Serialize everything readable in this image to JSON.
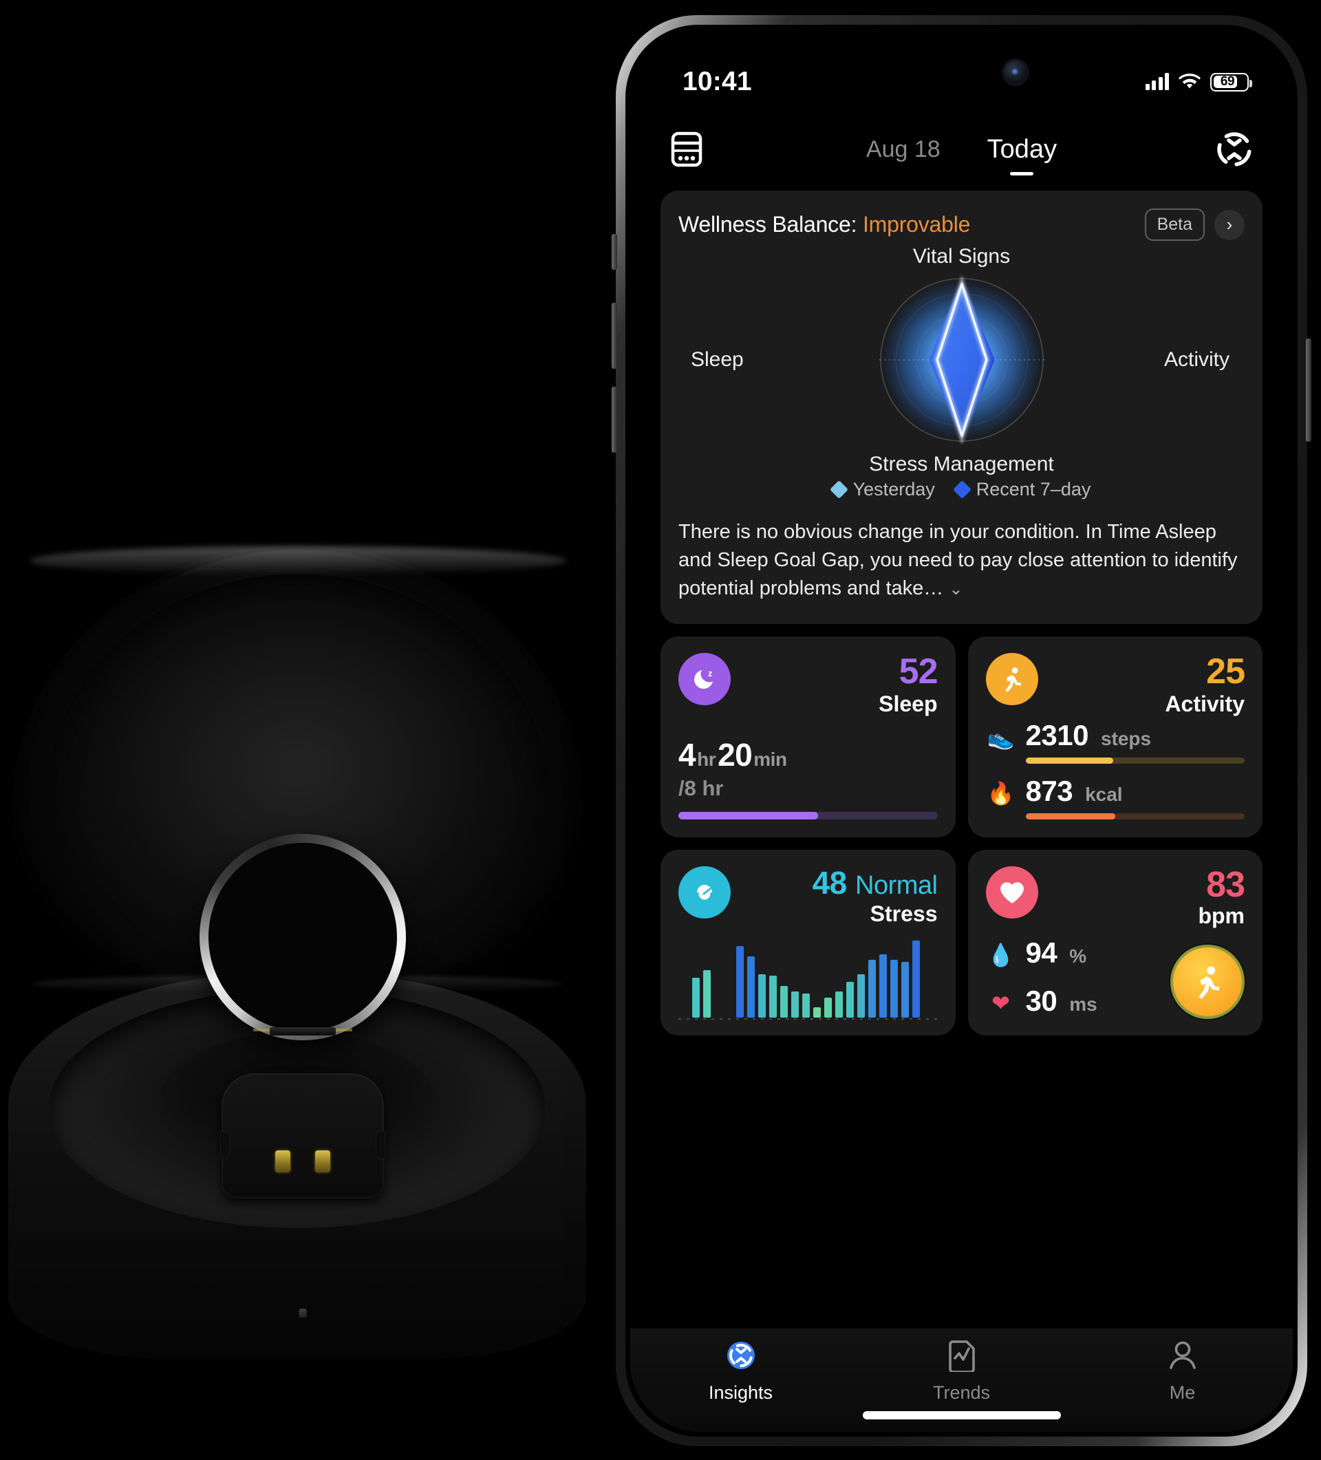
{
  "product": {
    "name": "smart-ring-charging-case",
    "description": "Black smart ring charging case with lid open and silver smart ring resting in the cradle"
  },
  "phone": {
    "status_bar": {
      "clock": "10:41",
      "signal_icon": "cellular-signal-icon",
      "wifi_icon": "wifi-icon",
      "battery_icon": "battery-icon",
      "battery_level": "69"
    },
    "home_indicator": "home-indicator"
  },
  "header": {
    "calendar_icon": "calendar-icon",
    "date": "Aug 18",
    "today": "Today",
    "refresh_icon": "refresh-icon"
  },
  "wellness": {
    "title_prefix": "Wellness Balance: ",
    "status": "Improvable",
    "status_color": "#e8903a",
    "beta_badge": "Beta",
    "chevron": "›",
    "description": "There is no obvious change in your condition. In Time Asleep and Sleep Goal Gap, you need to pay close attention to identify potential problems and take…",
    "expand_chevron": "⌄",
    "legend": [
      {
        "label": "Yesterday",
        "color": "#7fc8e8"
      },
      {
        "label": "Recent 7–day",
        "color": "#2b5fe8"
      }
    ]
  },
  "chart_data": {
    "type": "radar",
    "title": "Wellness Balance",
    "categories": [
      "Vital Signs",
      "Activity",
      "Stress Management",
      "Sleep"
    ],
    "axis_angles_deg": [
      270,
      0,
      90,
      180
    ],
    "rmax": 100,
    "grid": "concentric-rings-dotted-axes",
    "legend_position": "bottom",
    "series": [
      {
        "name": "Yesterday",
        "color": "#d9ecff",
        "values": [
          95,
          28,
          95,
          28
        ]
      },
      {
        "name": "Recent 7–day",
        "color": "#2b5fe8",
        "values": [
          88,
          40,
          88,
          40
        ]
      }
    ]
  },
  "metrics": {
    "sleep": {
      "icon": "sleep-moon-icon",
      "icon_color": "#9b5de5",
      "score": "52",
      "score_color": "#a86ef0",
      "label": "Sleep",
      "hours": "4",
      "hours_unit": "hr",
      "minutes": "20",
      "minutes_unit": "min",
      "goal": "/8 hr",
      "progress_pct": 54,
      "bar_color": "#a86ef0",
      "bar_track": "#3a2f4d"
    },
    "activity": {
      "icon": "running-person-icon",
      "icon_color": "#f5ab2e",
      "score": "25",
      "score_color": "#f5ab2e",
      "label": "Activity",
      "rows": [
        {
          "icon": "sneaker-icon",
          "glyph": "👟",
          "value": "2310",
          "unit": "steps",
          "progress_pct": 40,
          "color": "#f5c344",
          "track": "#4a3f22"
        },
        {
          "icon": "flame-icon",
          "glyph": "🔥",
          "value": "873",
          "unit": "kcal",
          "progress_pct": 41,
          "color": "#f07a3c",
          "track": "#472f24"
        }
      ]
    },
    "stress": {
      "icon": "stress-gauge-icon",
      "icon_color": "#2bbcd9",
      "score": "48",
      "word": "Normal",
      "score_color": "#35c4e0",
      "label": "Stress",
      "chart": {
        "type": "bar",
        "values": [
          0,
          40,
          48,
          0,
          0,
          72,
          62,
          44,
          42,
          32,
          26,
          24,
          10,
          20,
          26,
          36,
          44,
          58,
          64,
          58,
          56,
          78
        ],
        "colors": [
          "#3ba7c9",
          "#4bc3c0",
          "#59cfb4",
          "#3ba7c9",
          "#3ba7c9",
          "#2f6fe0",
          "#2f7ddc",
          "#45b7c6",
          "#4cc3bd",
          "#52c9b8",
          "#4ec5bb",
          "#50c7b9",
          "#6ed8a0",
          "#62d4ab",
          "#55cbb6",
          "#4dc0c2",
          "#45b2cc",
          "#3a8fd8",
          "#3080e2",
          "#3383e0",
          "#3a86dd",
          "#2f6fe0"
        ]
      }
    },
    "heart": {
      "icon": "heart-icon",
      "icon_color": "#f05a72",
      "value": "83",
      "value_color": "#f05a72",
      "unit": "bpm",
      "rows": [
        {
          "icon": "blood-oxygen-drop-icon",
          "glyph": "💧",
          "value": "94",
          "unit": "%"
        },
        {
          "icon": "hrv-heart-pulse-icon",
          "glyph": "❤",
          "value": "30",
          "unit": "ms"
        }
      ],
      "workout_fab": "workout-running-fab"
    }
  },
  "tabbar": [
    {
      "id": "insights",
      "icon": "insights-ring-icon",
      "label": "Insights",
      "active": true
    },
    {
      "id": "trends",
      "icon": "trends-chart-icon",
      "label": "Trends",
      "active": false
    },
    {
      "id": "me",
      "icon": "person-icon",
      "label": "Me",
      "active": false
    }
  ]
}
